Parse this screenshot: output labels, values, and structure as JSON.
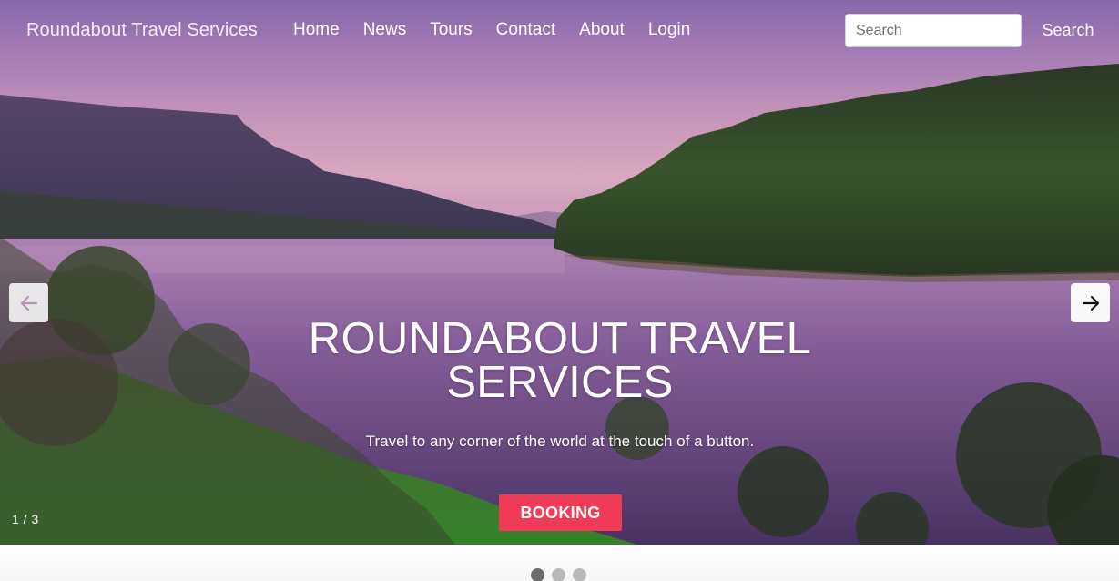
{
  "navbar": {
    "brand": "Roundabout Travel Services",
    "links": [
      {
        "label": "Home"
      },
      {
        "label": "News"
      },
      {
        "label": "Tours"
      },
      {
        "label": "Contact"
      },
      {
        "label": "About"
      },
      {
        "label": "Login"
      }
    ],
    "search": {
      "placeholder": "Search",
      "value": "",
      "button_label": "Search"
    }
  },
  "carousel": {
    "title": "ROUNDABOUT TRAVEL SERVICES",
    "subtitle": "Travel to any corner of the world at the touch of a button.",
    "cta_label": "BOOKING",
    "counter": "1 / 3",
    "current_slide": 1,
    "total_slides": 3,
    "prev_icon": "arrow-left-icon",
    "next_icon": "arrow-right-icon"
  },
  "colors": {
    "accent": "#f03b56",
    "dot_active": "#6c6c6c",
    "dot_inactive": "#b9b9b9"
  }
}
